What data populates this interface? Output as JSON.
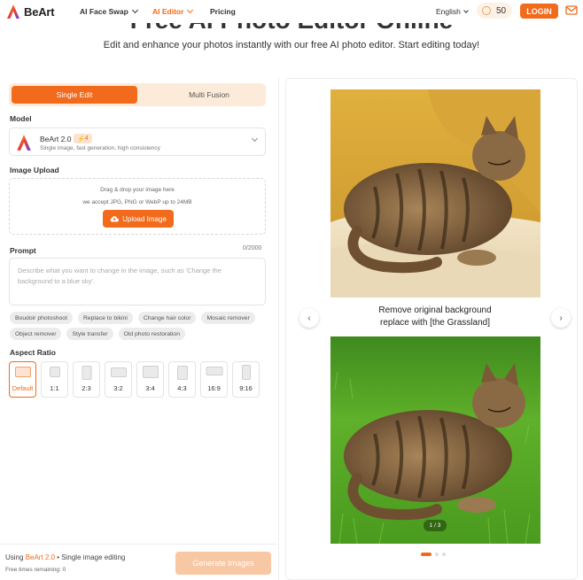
{
  "header": {
    "brand": "BeArt",
    "nav": [
      {
        "label": "AI Face Swap",
        "dropdown": true
      },
      {
        "label": "AI Editor",
        "dropdown": true,
        "active": true
      },
      {
        "label": "Pricing",
        "dropdown": false
      }
    ],
    "language": "English",
    "credits": "50",
    "login_label": "LOGIN"
  },
  "hero": {
    "title": "Free AI Photo Editor Online",
    "subtitle": "Edit and enhance your photos instantly with our free AI photo editor. Start editing today!"
  },
  "editor": {
    "tabs": [
      "Single Edit",
      "Multi Fusion"
    ],
    "active_tab": "Single Edit",
    "model_label": "Model",
    "model": {
      "name": "BeArt 2.0",
      "badge": "4",
      "description": "Single image, fast generation, high consistency"
    },
    "upload_label": "Image Upload",
    "upload": {
      "line1": "Drag & drop your image here",
      "line2": "we accept JPG, PNG or WebP up to 24MB",
      "button": "Upload Image"
    },
    "prompt_label": "Prompt",
    "prompt_count": "0/2000",
    "prompt_placeholder": "Describe what you want to change in the image, such as 'Change the background to a blue sky'.",
    "chips": [
      "Boudoir photoshoot",
      "Replace to bikini",
      "Change hair color",
      "Mosaic remover",
      "Object remover",
      "Style transfer",
      "Old photo restoration"
    ],
    "aspect_label": "Aspect Ratio",
    "aspect_ratios": [
      "Default",
      "1:1",
      "2:3",
      "3:2",
      "3:4",
      "4:3",
      "16:9",
      "9:16"
    ],
    "selected_ratio": "Default",
    "footer": {
      "using_prefix": "Using ",
      "using_model": "BeArt 2.0",
      "using_suffix": " • Single image editing",
      "free_times": "Free times remaining: 0",
      "generate": "Generate Images"
    }
  },
  "preview": {
    "caption_line1": "Remove original background",
    "caption_line2": "replace with [the Grassland]",
    "pager": "1 / 3",
    "slides": 3,
    "active_slide": 1
  },
  "colors": {
    "accent": "#f26a1b",
    "accent_light": "#fcebd9"
  }
}
